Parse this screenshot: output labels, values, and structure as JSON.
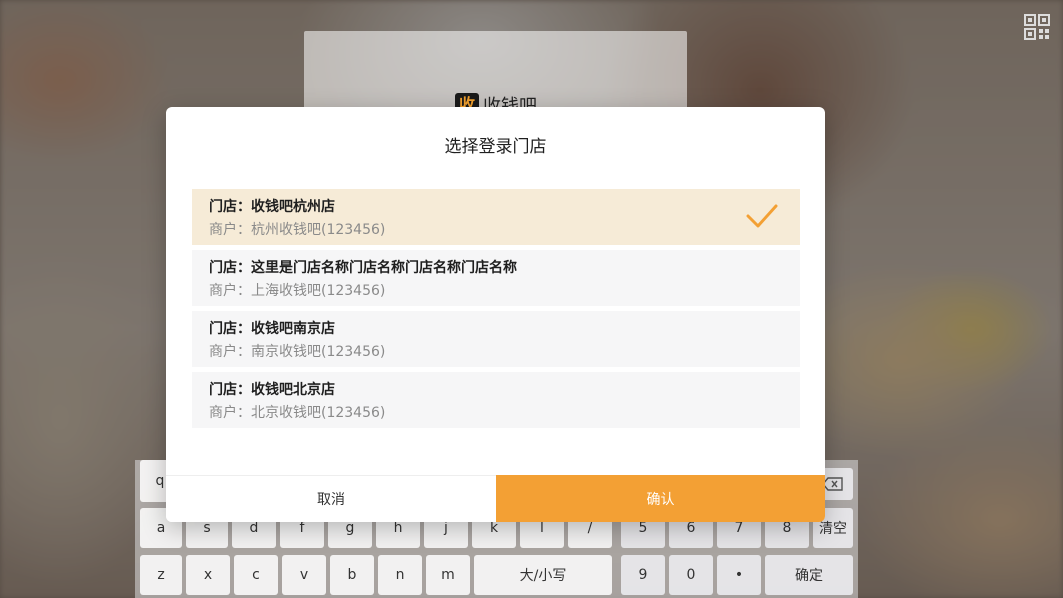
{
  "brand": {
    "logo_glyph": "收",
    "name": "收钱吧"
  },
  "dialog": {
    "title": "选择登录门店",
    "stores": [
      {
        "name": "门店：收钱吧杭州店",
        "merchant": "商户：杭州收钱吧(123456)",
        "selected": true
      },
      {
        "name": "门店：这里是门店名称门店名称门店名称门店名称",
        "merchant": "商户：上海收钱吧(123456)",
        "selected": false
      },
      {
        "name": "门店：收钱吧南京店",
        "merchant": "商户：南京收钱吧(123456)",
        "selected": false
      },
      {
        "name": "门店：收钱吧北京店",
        "merchant": "商户：北京收钱吧(123456)",
        "selected": false
      }
    ],
    "cancel_label": "取消",
    "confirm_label": "确认"
  },
  "keyboard": {
    "row1": [
      "q"
    ],
    "row2": [
      "a",
      "s",
      "d",
      "f",
      "g",
      "h",
      "j",
      "k",
      "l",
      "/",
      "5",
      "6",
      "7",
      "8",
      "清空"
    ],
    "row3": [
      "z",
      "x",
      "c",
      "v",
      "b",
      "n",
      "m",
      "大/小写",
      "9",
      "0",
      "•",
      "确定"
    ],
    "backspace_icon": "backspace-icon"
  },
  "colors": {
    "accent": "#f3a034",
    "selected_bg": "#f6ebd7"
  }
}
